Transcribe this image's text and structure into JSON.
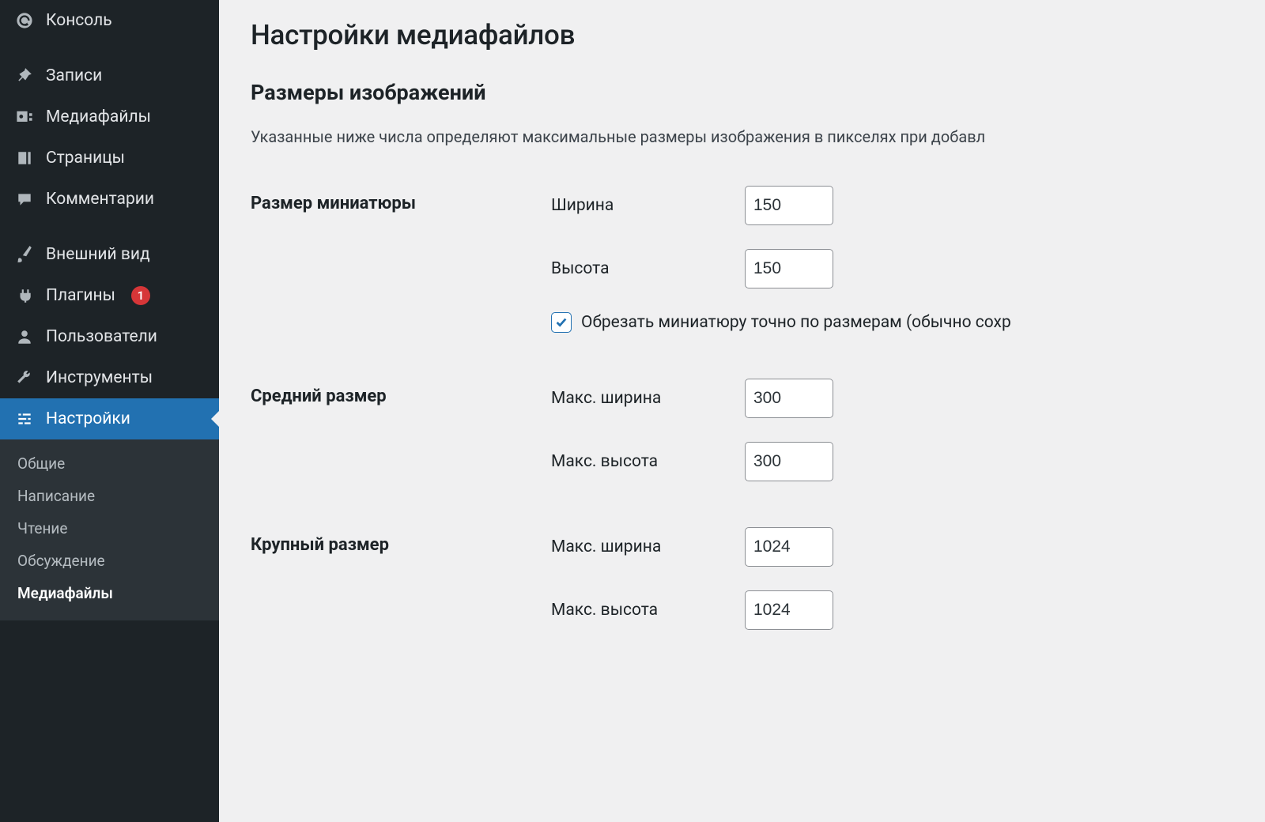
{
  "sidebar": {
    "items": [
      {
        "label": "Консоль"
      },
      {
        "label": "Записи"
      },
      {
        "label": "Медиафайлы"
      },
      {
        "label": "Страницы"
      },
      {
        "label": "Комментарии"
      },
      {
        "label": "Внешний вид"
      },
      {
        "label": "Плагины",
        "badge": "1"
      },
      {
        "label": "Пользователи"
      },
      {
        "label": "Инструменты"
      },
      {
        "label": "Настройки"
      }
    ],
    "submenu": [
      {
        "label": "Общие"
      },
      {
        "label": "Написание"
      },
      {
        "label": "Чтение"
      },
      {
        "label": "Обсуждение"
      },
      {
        "label": "Медиафайлы"
      }
    ]
  },
  "page": {
    "title": "Настройки медиафайлов",
    "section_heading": "Размеры изображений",
    "description": "Указанные ниже числа определяют максимальные размеры изображения в пикселях при добавл"
  },
  "settings": {
    "thumbnail": {
      "group_label": "Размер миниатюры",
      "width_label": "Ширина",
      "width_value": "150",
      "height_label": "Высота",
      "height_value": "150",
      "crop_label": "Обрезать миниатюру точно по размерам (обычно сохр",
      "crop_checked": true
    },
    "medium": {
      "group_label": "Средний размер",
      "width_label": "Макс. ширина",
      "width_value": "300",
      "height_label": "Макс. высота",
      "height_value": "300"
    },
    "large": {
      "group_label": "Крупный размер",
      "width_label": "Макс. ширина",
      "width_value": "1024",
      "height_label": "Макс. высота",
      "height_value": "1024"
    }
  }
}
